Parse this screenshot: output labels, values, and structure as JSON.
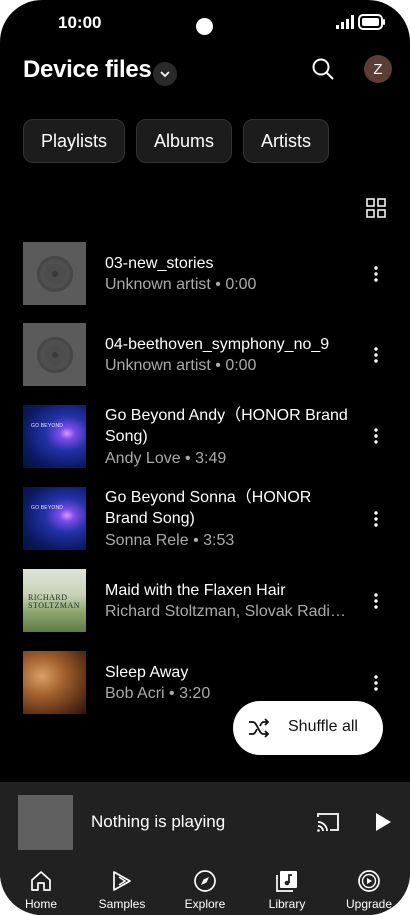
{
  "status_bar": {
    "time": "10:00"
  },
  "header": {
    "title": "Device files",
    "avatar_initial": "Z"
  },
  "chips": [
    "Playlists",
    "Albums",
    "Artists"
  ],
  "tracks": [
    {
      "title": "03-new_stories",
      "subtitle": "Unknown artist • 0:00",
      "art": "placeholder-disc"
    },
    {
      "title": "04-beethoven_symphony_no_9",
      "subtitle": "Unknown artist • 0:00",
      "art": "placeholder-disc"
    },
    {
      "title": "Go Beyond Andy（HONOR Brand Song)",
      "subtitle": "Andy Love • 3:49",
      "art": "go-beyond-cover",
      "cover_text": "GO BEYOND"
    },
    {
      "title": "Go Beyond Sonna（HONOR Brand Song)",
      "subtitle": "Sonna Rele • 3:53",
      "art": "go-beyond-cover",
      "cover_text": "GO BEYOND"
    },
    {
      "title": "Maid with the Flaxen Hair",
      "subtitle": "Richard Stoltzman, Slovak Radi…",
      "art": "stoltzman-cover",
      "cover_text": "RICHARD STOLTZMAN"
    },
    {
      "title": "Sleep Away",
      "subtitle": "Bob Acri • 3:20",
      "art": "piano-cover"
    }
  ],
  "shuffle": {
    "label": "Shuffle all"
  },
  "miniplayer": {
    "text": "Nothing is playing"
  },
  "nav": [
    {
      "label": "Home",
      "icon": "home-icon"
    },
    {
      "label": "Samples",
      "icon": "samples-icon"
    },
    {
      "label": "Explore",
      "icon": "compass-icon"
    },
    {
      "label": "Library",
      "icon": "library-icon"
    },
    {
      "label": "Upgrade",
      "icon": "upgrade-icon"
    }
  ],
  "colors": {
    "background": "#000000",
    "surface": "#212121",
    "chip": "#1c1c1c",
    "secondary_text": "#aaaaaa"
  }
}
